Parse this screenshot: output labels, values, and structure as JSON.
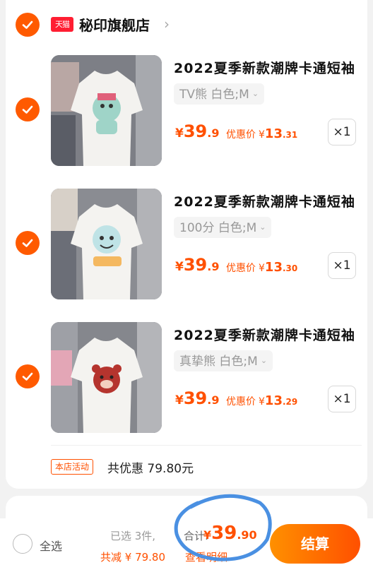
{
  "store": {
    "badge": "天猫",
    "name": "秘印旗舰店",
    "chevron": "›"
  },
  "items": [
    {
      "title": "2022夏季新款潮牌卡通短袖",
      "sku": "TV熊 白色;M",
      "price": {
        "currency": "¥",
        "int": "39",
        "dec": ".9"
      },
      "promo": {
        "label": "优惠价",
        "currency": "¥",
        "int": "13",
        "dec": ".31"
      },
      "qty": "×1"
    },
    {
      "title": "2022夏季新款潮牌卡通短袖",
      "sku": "100分 白色;M",
      "price": {
        "currency": "¥",
        "int": "39",
        "dec": ".9"
      },
      "promo": {
        "label": "优惠价",
        "currency": "¥",
        "int": "13",
        "dec": ".30"
      },
      "qty": "×1"
    },
    {
      "title": "2022夏季新款潮牌卡通短袖",
      "sku": "真挚熊 白色;M",
      "price": {
        "currency": "¥",
        "int": "39",
        "dec": ".9"
      },
      "promo": {
        "label": "优惠价",
        "currency": "¥",
        "int": "13",
        "dec": ".29"
      },
      "qty": "×1"
    }
  ],
  "activity": {
    "tag": "本店活动",
    "text": "共优惠 79.80元"
  },
  "footer": {
    "select_all": "全选",
    "selected": "已选 3件,",
    "total_label": "合计:",
    "total": {
      "currency": "¥",
      "int": "39",
      "dec": ".90"
    },
    "discount": "共减 ¥ 79.80",
    "detail": "查看明细",
    "checkout": "结算"
  },
  "colors": {
    "accent": "#ff5000",
    "check": "#ff5a00",
    "tmall": "#ff1e32",
    "annotation_circle": "#4a90e2"
  }
}
